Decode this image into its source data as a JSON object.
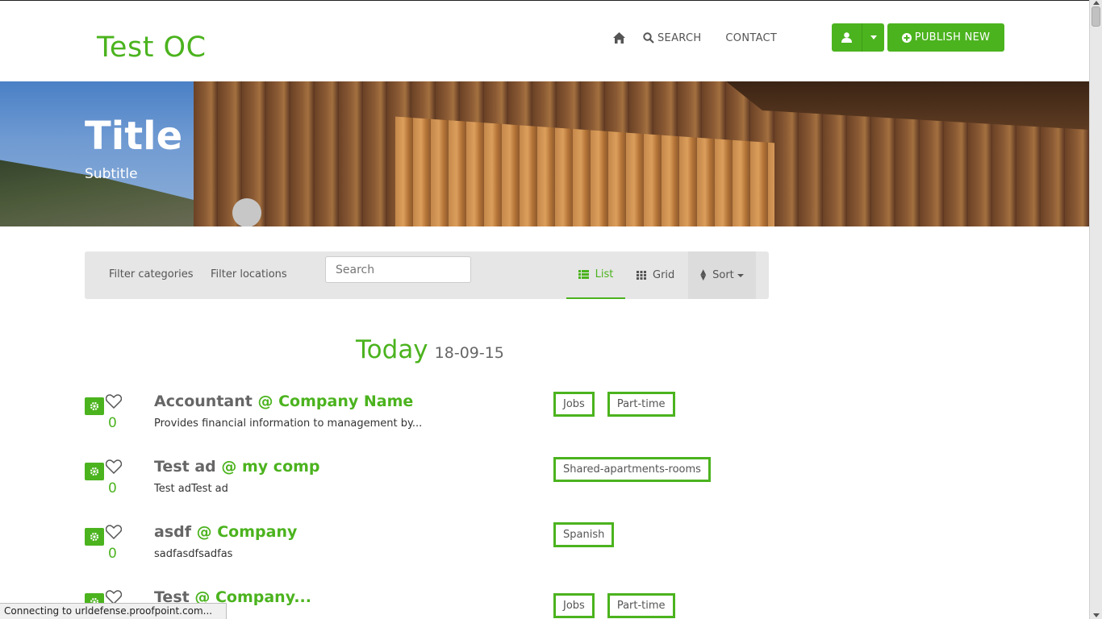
{
  "header": {
    "brand": "Test OC",
    "nav": {
      "search": "SEARCH",
      "contact": "CONTACT"
    },
    "publish": "PUBLISH NEW"
  },
  "hero": {
    "title": "Title",
    "subtitle": "Subtitle"
  },
  "filters": {
    "categories": "Filter categories",
    "locations": "Filter locations",
    "search_placeholder": "Search",
    "list": "List",
    "grid": "Grid",
    "sort": "Sort"
  },
  "listing": {
    "today_label": "Today",
    "today_date": "18-09-15",
    "ads": [
      {
        "title": "Accountant",
        "company": "@ Company Name",
        "desc": "Provides financial information to management by...",
        "count": "0",
        "tags": [
          "Jobs",
          "Part-time"
        ]
      },
      {
        "title": "Test ad",
        "company": "@ my comp",
        "desc": "Test adTest ad",
        "count": "0",
        "tags": [
          "Shared-apartments-rooms"
        ]
      },
      {
        "title": "asdf",
        "company": "@ Company",
        "desc": "sadfasdfsadfas",
        "count": "0",
        "tags": [
          "Spanish"
        ]
      },
      {
        "title": "Test",
        "company": "@ Company...",
        "desc": "",
        "count": "",
        "tags": [
          "Jobs",
          "Part-time"
        ]
      }
    ]
  },
  "status": "Connecting to urldefense.proofpoint.com...",
  "colors": {
    "accent": "#4bb31e"
  },
  "icons": [
    "home-icon",
    "search-icon",
    "user-icon",
    "caret-down-icon",
    "plus-circle-icon",
    "list-icon",
    "grid-icon",
    "sort-icon",
    "gear-icon",
    "heart-icon"
  ]
}
